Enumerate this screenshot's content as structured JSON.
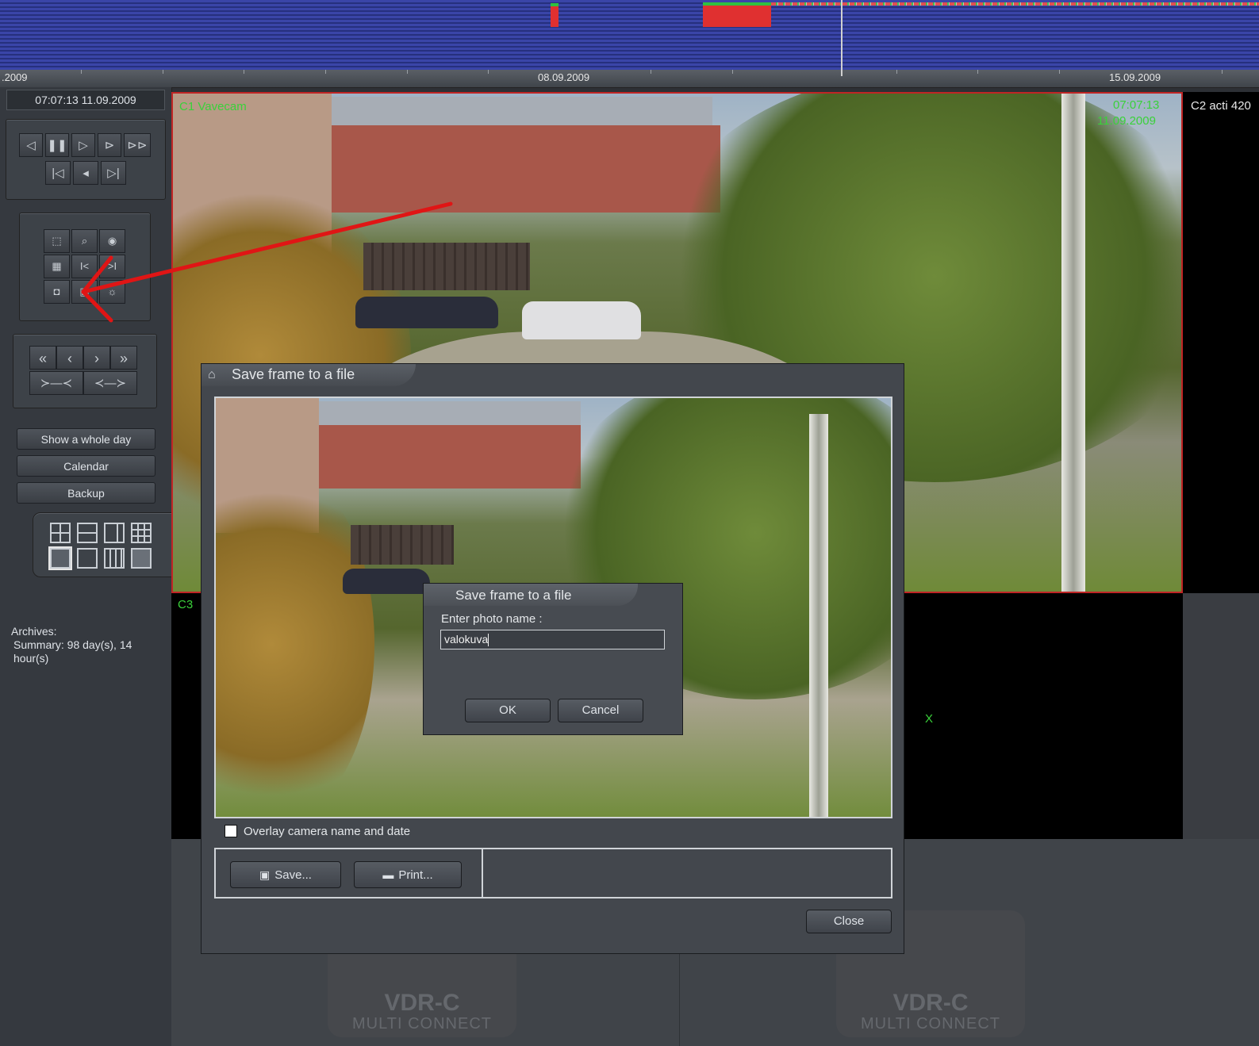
{
  "timeline": {
    "labels": [
      ".2009",
      "08.09.2009",
      "15.09.2009"
    ]
  },
  "sidebar": {
    "current_time": "07:07:13 11.09.2009",
    "buttons": {
      "show_whole_day": "Show a whole day",
      "calendar": "Calendar",
      "backup": "Backup"
    },
    "playback_icons": [
      "prev-frame-icon",
      "pause-icon",
      "play-icon",
      "next-frame-icon",
      "fast-forward-icon",
      "skip-start-icon",
      "sound-icon",
      "skip-end-icon"
    ],
    "tool_icons": [
      "select-icon",
      "zoom-region-icon",
      "eye-icon",
      "grid-icon",
      "mark-start-icon",
      "mark-end-icon",
      "camera-snapshot-icon",
      "save-frame-icon",
      "brightness-icon"
    ],
    "nav_symbols": [
      "«",
      "‹",
      "›",
      "»",
      "≻—≺",
      "≺—≻"
    ],
    "archives": {
      "title": "Archives:",
      "summary": "Summary: 98 day(s), 14 hour(s)"
    }
  },
  "cameras": {
    "cam1": {
      "name": "C1 Vavecam",
      "time": "07:07:13",
      "date": "11.09.2009"
    },
    "cam2": {
      "name": "C2 acti 420"
    },
    "cam3": {
      "name": "C3"
    },
    "marker": "X"
  },
  "logos": [
    {
      "title": "VDR-C",
      "subtitle": "MULTI CONNECT"
    },
    {
      "title": "VDR-C",
      "subtitle": "MULTI CONNECT"
    }
  ],
  "save_dialog": {
    "title": "Save frame to a file",
    "overlay_label": "Overlay camera name and date",
    "overlay_checked": false,
    "save_label": "Save...",
    "print_label": "Print...",
    "close_label": "Close"
  },
  "name_dialog": {
    "title": "Save frame to a file",
    "prompt": "Enter photo name :",
    "value": "valokuva",
    "ok_label": "OK",
    "cancel_label": "Cancel"
  }
}
